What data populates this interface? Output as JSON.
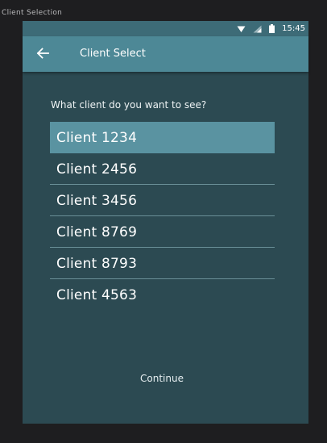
{
  "window": {
    "title": "Client Selection"
  },
  "status_bar": {
    "time": "15:45",
    "icons": [
      "wifi-icon",
      "signal-icon",
      "battery-icon"
    ]
  },
  "app_bar": {
    "back_icon": "arrow-left-icon",
    "title": "Client Select"
  },
  "main": {
    "prompt": "What client do you want to see?",
    "selected_index": 0,
    "clients": [
      {
        "label": "Client 1234"
      },
      {
        "label": "Client 2456"
      },
      {
        "label": "Client 3456"
      },
      {
        "label": "Client 8769"
      },
      {
        "label": "Client 8793"
      },
      {
        "label": "Client 4563"
      }
    ],
    "continue_label": "Continue"
  },
  "colors": {
    "background": "#2c4a52",
    "status_bar": "#3d6b77",
    "app_bar": "#4d8896",
    "selected_row": "#5a93a1",
    "divider": "#6a8f97"
  }
}
